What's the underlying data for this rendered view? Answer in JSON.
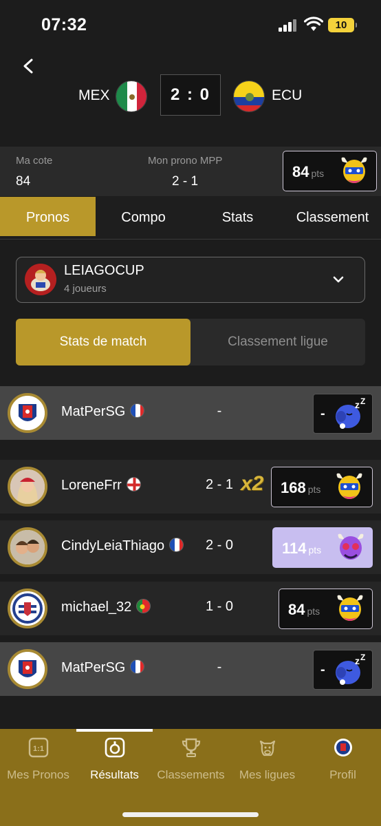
{
  "status_bar": {
    "time": "07:32",
    "battery": "10"
  },
  "match": {
    "home": {
      "code": "MEX",
      "flag_icon": "mexico-flag-icon"
    },
    "away": {
      "code": "ECU",
      "flag_icon": "ecuador-flag-icon"
    },
    "score": "2 : 0"
  },
  "my_summary": {
    "cote_label": "Ma cote",
    "cote_value": "84",
    "prono_label": "Mon prono MPP",
    "prono_value": "2 - 1",
    "points": "84",
    "points_unit": "pts"
  },
  "tabs": [
    {
      "label": "Pronos",
      "active": true
    },
    {
      "label": "Compo",
      "active": false
    },
    {
      "label": "Stats",
      "active": false
    },
    {
      "label": "Classement",
      "active": false
    }
  ],
  "league": {
    "name": "LEIAGOCUP",
    "players": "4 joueurs"
  },
  "segmented": {
    "active": "Stats de match",
    "inactive": "Classement ligue"
  },
  "players": [
    {
      "name": "MatPerSG",
      "flag": "france",
      "prono": "-",
      "result": "-",
      "points_unit": "",
      "mascot": "sleeping-mascot-icon",
      "highlight": true
    },
    {
      "name": "LoreneFrr",
      "flag": "england",
      "prono": "2 - 1",
      "multiplier": "x2",
      "result": "168",
      "points_unit": "pts",
      "mascot": "gold-mascot-icon"
    },
    {
      "name": "CindyLeiaThiago",
      "flag": "france",
      "prono": "2 - 0",
      "result": "114",
      "points_unit": "pts",
      "mascot": "purple-mascot-icon"
    },
    {
      "name": "michael_32",
      "flag": "portugal",
      "prono": "1 - 0",
      "result": "84",
      "points_unit": "pts",
      "mascot": "gold-mascot-icon"
    },
    {
      "name": "MatPerSG",
      "flag": "france",
      "prono": "-",
      "result": "-",
      "points_unit": "",
      "mascot": "sleeping-mascot-icon",
      "highlight": true
    }
  ],
  "bottom_nav": [
    {
      "label": "Mes Pronos",
      "icon": "one-vs-one-icon"
    },
    {
      "label": "Résultats",
      "icon": "whistle-icon",
      "active": true
    },
    {
      "label": "Classements",
      "icon": "trophy-icon"
    },
    {
      "label": "Mes ligues",
      "icon": "cow-icon"
    },
    {
      "label": "Profil",
      "icon": "profile-badge-icon"
    }
  ],
  "colors": {
    "gold": "#b9982a",
    "nav_gold": "#8a6f1a",
    "background": "#1c1c1c",
    "purple_box": "#c8bef0"
  }
}
